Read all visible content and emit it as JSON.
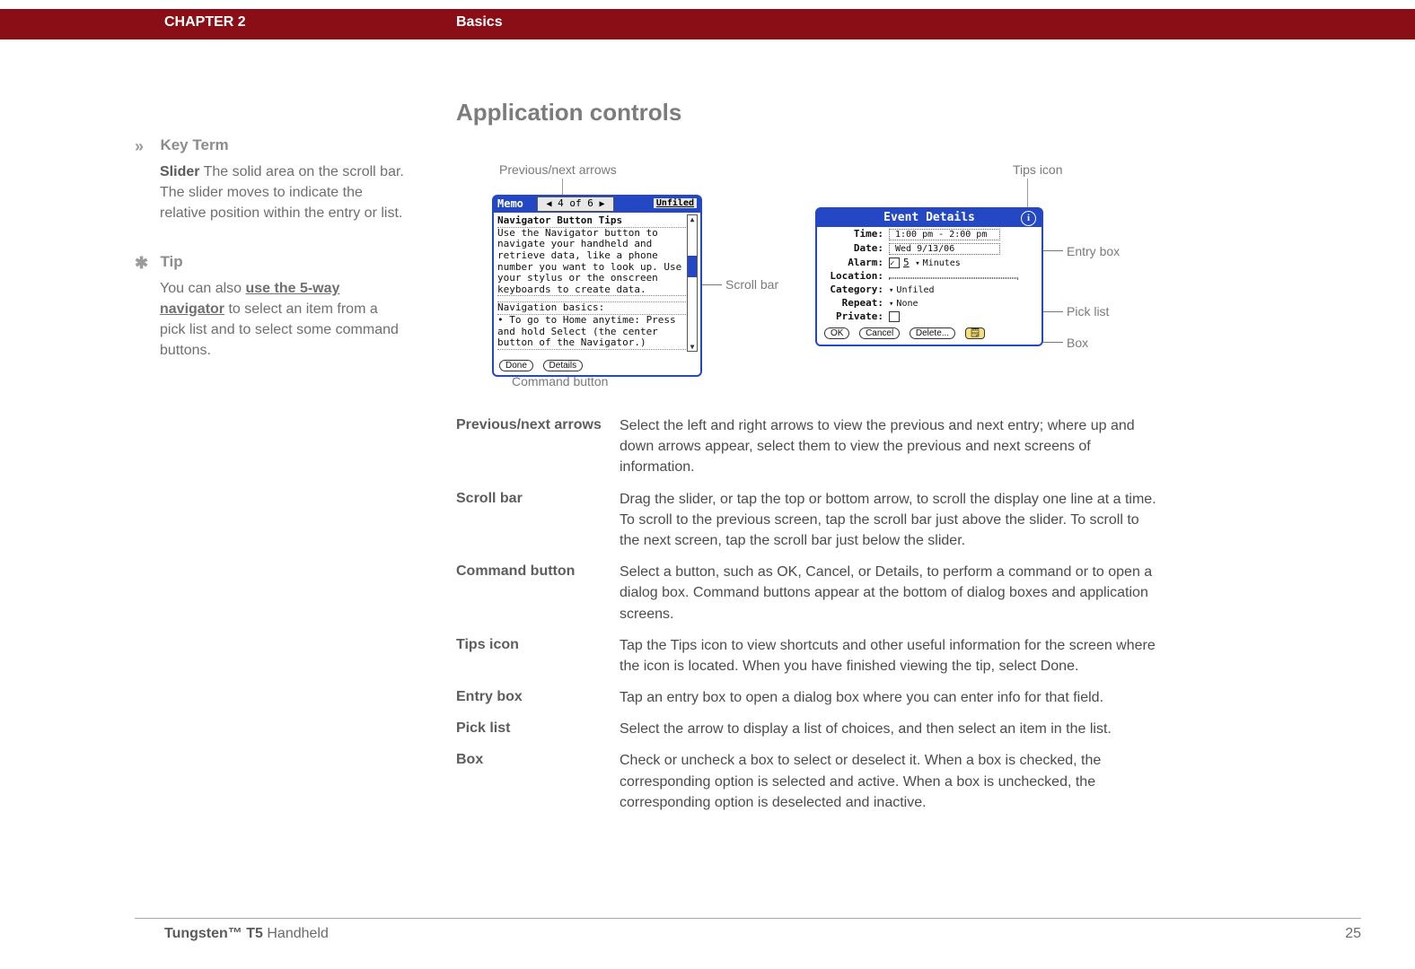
{
  "header": {
    "chapter": "CHAPTER 2",
    "section": "Basics"
  },
  "sidebar": {
    "keyterm": {
      "icon": "»",
      "head": "Key Term",
      "word": "Slider",
      "gap": " ",
      "def": "The solid area on the scroll bar. The slider moves to indicate the relative position within the entry or list."
    },
    "tip": {
      "icon": "✱",
      "head": "Tip",
      "pre": "You can also ",
      "link": "use the 5-way navigator",
      "post": " to select an item from a pick list and to select some command buttons."
    }
  },
  "main": {
    "title": "Application controls",
    "callouts": {
      "prevnext": "Previous/next arrows",
      "scrollbar": "Scroll bar",
      "cmdbtn": "Command button",
      "tipsicon": "Tips icon",
      "entrybox": "Entry box",
      "picklist": "Pick list",
      "box": "Box"
    },
    "memo": {
      "label": "Memo",
      "counter": "4 of 6",
      "category": "Unfiled",
      "line1": "Navigator Button Tips",
      "line2": "Use the Navigator button to navigate your handheld and retrieve data, like a phone number you want to look up. Use your stylus or the onscreen keyboards to create data.",
      "line3": "Navigation basics:",
      "line4": "• To go to Home anytime: Press and hold Select (the center button of the Navigator.)",
      "btn_done": "Done",
      "btn_details": "Details"
    },
    "event": {
      "title": "Event Details",
      "rows": {
        "time_l": "Time:",
        "time_v": "1:00 pm - 2:00 pm",
        "date_l": "Date:",
        "date_v": "Wed 9/13/06",
        "alarm_l": "Alarm:",
        "alarm_v": "5",
        "alarm_u": "Minutes",
        "loc_l": "Location:",
        "loc_v": "",
        "cat_l": "Category:",
        "cat_v": "Unfiled",
        "rep_l": "Repeat:",
        "rep_v": "None",
        "priv_l": "Private:"
      },
      "btn_ok": "OK",
      "btn_cancel": "Cancel",
      "btn_delete": "Delete...",
      "btn_note": "🗒"
    },
    "defs": [
      {
        "term": "Previous/next arrows",
        "body": "Select the left and right arrows to view the previous and next entry; where up and down arrows appear, select them to view the previous and next screens of information."
      },
      {
        "term": "Scroll bar",
        "body": "Drag the slider, or tap the top or bottom arrow, to scroll the display one line at a time. To scroll to the previous screen, tap the scroll bar just above the slider. To scroll to the next screen, tap the scroll bar just below the slider."
      },
      {
        "term": "Command button",
        "body": "Select a button, such as OK, Cancel, or Details, to perform a command or to open a dialog box. Command buttons appear at the bottom of dialog boxes and application screens."
      },
      {
        "term": "Tips icon",
        "body": "Tap the Tips icon to view shortcuts and other useful information for the screen where the icon is located. When you have finished viewing the tip, select Done."
      },
      {
        "term": "Entry box",
        "body": "Tap an entry box to open a dialog box where you can enter info for that field."
      },
      {
        "term": "Pick list",
        "body": "Select the arrow to display a list of choices, and then select an item in the list."
      },
      {
        "term": "Box",
        "body": "Check or uncheck a box to select or deselect it. When a box is checked, the corresponding option is selected and active. When a box is unchecked, the corresponding option is deselected and inactive."
      }
    ]
  },
  "footer": {
    "product_strong": "Tungsten™ T5",
    "product_rest": " Handheld",
    "page": "25"
  }
}
